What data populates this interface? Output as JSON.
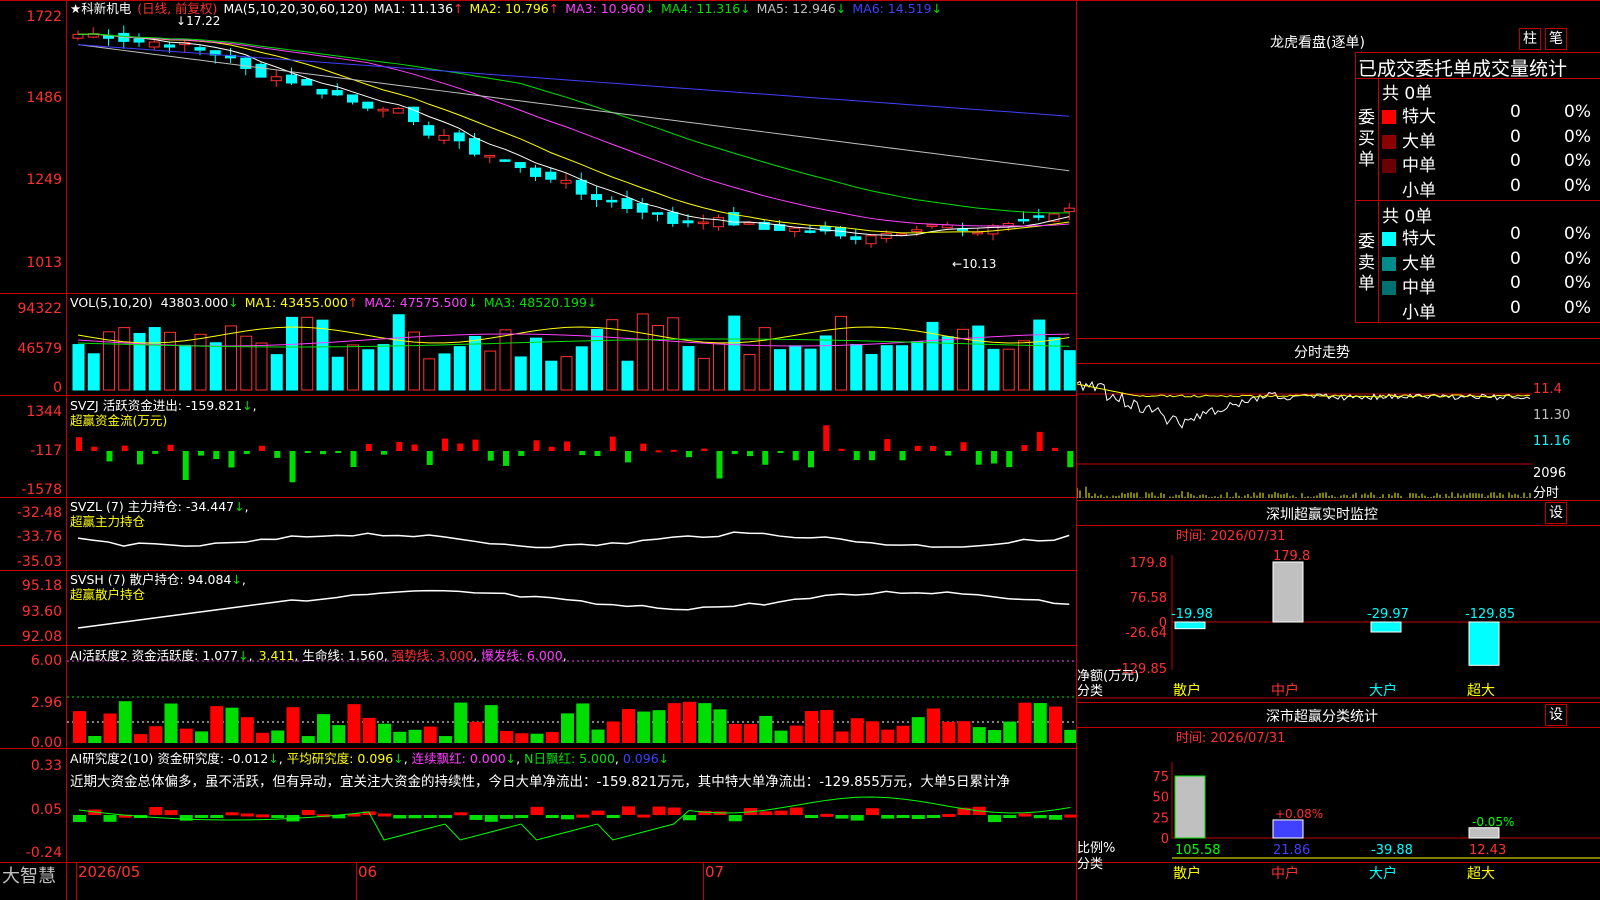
{
  "stock": {
    "name": "科新机电",
    "star": "★",
    "mode": "(日线, 前复权)",
    "high_mark": "17.22",
    "low_mark": "10.13"
  },
  "ma_header": {
    "label": "MA(5,10,20,30,60,120)",
    "items": [
      {
        "text": "MA1: 11.136",
        "arrow": "↑",
        "color": "#ffffff"
      },
      {
        "text": "MA2: 10.796",
        "arrow": "↑",
        "color": "#ffff00"
      },
      {
        "text": "MA3: 10.960",
        "arrow": "↓",
        "color": "#ff40ff"
      },
      {
        "text": "MA4: 11.316",
        "arrow": "↓",
        "color": "#00e000"
      },
      {
        "text": "MA5: 12.946",
        "arrow": "↓",
        "color": "#c0c0c0"
      },
      {
        "text": "MA6: 14.519",
        "arrow": "↓",
        "color": "#4040ff"
      }
    ]
  },
  "price_axis": [
    "1722",
    "1486",
    "1249",
    "1013"
  ],
  "vol_header": {
    "label": "VOL(5,10,20)",
    "value": "43803.000",
    "arrow": "↓",
    "ma1": "MA1: 43455.000",
    "ma1_arrow": "↑",
    "ma2": "MA2: 47575.500",
    "ma2_arrow": "↓",
    "ma3": "MA3: 48520.199",
    "ma3_arrow": "↓"
  },
  "vol_axis": [
    "94322",
    "46579",
    "0"
  ],
  "svzj_header": {
    "label": "SVZJ  活跃资金进出: -159.821",
    "arrow": "↓",
    "sub": "超赢资金流(万元)"
  },
  "svzj_axis": [
    "1344",
    "-117",
    "-1578"
  ],
  "svzl_header": {
    "label": "SVZL (7) 主力持仓: -34.447",
    "arrow": "↓",
    "sub": "超赢主力持仓"
  },
  "svzl_axis": [
    "-32.48",
    "-33.76",
    "-35.03"
  ],
  "svsh_header": {
    "label": "SVSH (7) 散户持仓: 94.084",
    "arrow": "↓",
    "sub": "超赢散户持仓"
  },
  "svsh_axis": [
    "95.18",
    "93.60",
    "92.08"
  ],
  "ai1_header": {
    "label": "AI活跃度2 资金活跃度: 1.077",
    "arrow": "↓",
    "v2": "3.411",
    "life": "生命线: 1.560",
    "strong": "强势线: 3.000",
    "burst": "爆发线: 6.000"
  },
  "ai1_axis": [
    "6.00",
    "2.96",
    "0.00"
  ],
  "ai2_header": {
    "label": "AI研究度2(10) 资金研究度: -0.012",
    "arrow": "↓",
    "avg": "平均研究度: 0.096",
    "avg_arrow": "↓",
    "red": "连续飘红: 0.000",
    "red_arrow": "↓",
    "nred": "N日飘红: 5.000",
    "nred_v": "0.096",
    "nred_arrow": "↓"
  },
  "ai2_text": "近期大资金总体偏多，虽不活跃，但有异动，宜关注大资金的持续性，今日大单净流出：-159.821万元，其中特大单净流出：-129.855万元，大单5日累计净",
  "ai2_axis": [
    "0.33",
    "0.05",
    "-0.24"
  ],
  "date_axis": [
    "2026/05",
    "06",
    "07"
  ],
  "brand": "大智慧",
  "longhu": {
    "title": "龙虎看盘(逐单)",
    "tab1": "柱",
    "tab2": "笔",
    "subtitle": "已成交委托单成交量统计",
    "buy": {
      "side": "委买单",
      "total": "共 0单",
      "rows": [
        {
          "label": "特大",
          "n": "0",
          "p": "0%",
          "color": "#ff0000"
        },
        {
          "label": "大单",
          "n": "0",
          "p": "0%",
          "color": "#8b0000"
        },
        {
          "label": "中单",
          "n": "0",
          "p": "0%",
          "color": "#6b0000"
        },
        {
          "label": "小单",
          "n": "0",
          "p": "0%",
          "color": "#000000"
        }
      ]
    },
    "sell": {
      "side": "委卖单",
      "total": "共 0单",
      "rows": [
        {
          "label": "特大",
          "n": "0",
          "p": "0%",
          "color": "#00ffff"
        },
        {
          "label": "大单",
          "n": "0",
          "p": "0%",
          "color": "#008b8b"
        },
        {
          "label": "中单",
          "n": "0",
          "p": "0%",
          "color": "#007070"
        },
        {
          "label": "小单",
          "n": "0",
          "p": "0%",
          "color": "#000000"
        }
      ]
    }
  },
  "intraday": {
    "title": "分时走势",
    "price_labels": [
      "11.4",
      "11.30",
      "11.16"
    ],
    "vol_label": "2096",
    "vol_unit": "分时"
  },
  "monitor": {
    "title": "深圳超赢实时监控",
    "btn": "设",
    "time": "时间: 2026/07/31",
    "axis": [
      "179.8",
      "76.58",
      "0",
      "-26.64",
      "-129.85"
    ],
    "unit": "净额(万元)",
    "cat_label": "分类"
  },
  "category": {
    "title": "深市超赢分类统计",
    "btn": "设",
    "time": "时间: 2026/07/31",
    "axis": [
      "75",
      "50",
      "25",
      "0"
    ],
    "ratio": "比例%",
    "cat_label": "分类"
  },
  "chart_data": [
    {
      "type": "bar",
      "title": "深圳超赢实时监控",
      "categories": [
        "散户",
        "中户",
        "大户",
        "超大"
      ],
      "values": [
        -19.98,
        179.8,
        -29.97,
        -129.85
      ],
      "ylabel": "净额(万元)",
      "ylim": [
        -129.85,
        179.8
      ]
    },
    {
      "type": "bar",
      "title": "深市超赢分类统计",
      "categories": [
        "散户",
        "中户",
        "大户",
        "超大"
      ],
      "values": [
        105.58,
        21.86,
        -39.88,
        12.43
      ],
      "annotations": [
        "+0.08%",
        "-0.05%"
      ],
      "ylabel": "比例%",
      "ylim": [
        0,
        75
      ]
    },
    {
      "type": "bar",
      "title": "",
      "categories": [
        "2026/05",
        "06",
        "07"
      ],
      "series": [
        {
          "name": "VOL",
          "values": [
            43803.0
          ]
        }
      ],
      "ylim": [
        0,
        94322
      ]
    }
  ]
}
